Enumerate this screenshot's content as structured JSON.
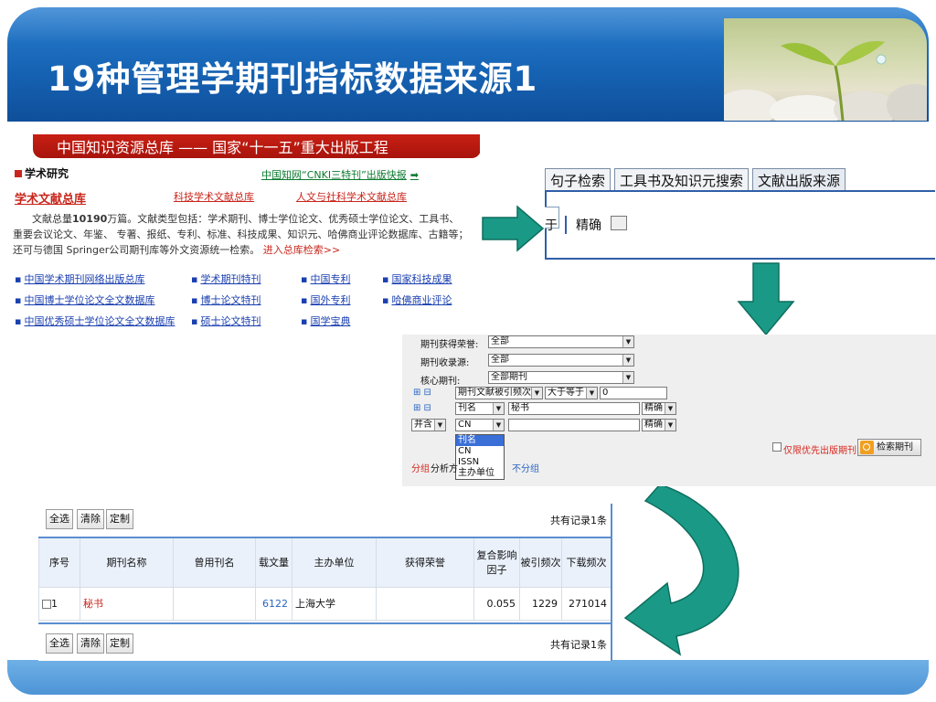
{
  "slide": {
    "title": "19种管理学期刊指标数据来源1"
  },
  "source_page": {
    "banner": "中国知识资源总库 —— 国家“十一五”重大出版工程",
    "section_heading": "学术研究",
    "news_link": "中国知网“CNKI三特刊”出版快报",
    "tabs": [
      "学术文献总库",
      "科技学术文献总库",
      "人文与社科学术文献总库"
    ],
    "desc_prefix": "文献总量",
    "desc_count": "10190",
    "desc_body": "万篇。文献类型包括：学术期刊、博士学位论文、优秀硕士学位论文、工具书、 重要会议论文、年鉴、 专著、报纸、专利、标准、科技成果、知识元、哈佛商业评论数据库、古籍等；还可与德国 Springer公司期刊库等外文资源统一检索。",
    "desc_enter": "进入总库检索>>",
    "links": [
      [
        "中国学术期刊网络出版总库",
        "学术期刊特刊",
        "中国专利",
        "国家科技成果"
      ],
      [
        "中国博士学位论文全文数据库",
        "博士论文特刊",
        "国外专利",
        "哈佛商业评论"
      ],
      [
        "中国优秀硕士学位论文全文数据库",
        "硕士论文特刊",
        "国学宝典"
      ]
    ]
  },
  "search_tabs": {
    "tabs": [
      "句子检索",
      "工具书及知识元搜索",
      "文献出版来源"
    ],
    "fragment_left": "于",
    "fragment_right": "精确"
  },
  "filter_form": {
    "rows": [
      {
        "label": "期刊获得荣誉:",
        "value": "全部"
      },
      {
        "label": "期刊收录源:",
        "value": "全部"
      },
      {
        "label": "核心期刊:",
        "value": "全部期刊"
      }
    ],
    "cite_row": {
      "pm": "⊞ ⊟",
      "field": "期刊文献被引频次",
      "op": "大于等于",
      "value": "0"
    },
    "name_row": {
      "pm": "⊞ ⊟",
      "field": "刊名",
      "value": "秘书",
      "match": "精确"
    },
    "cn_row": {
      "logic": "并含",
      "field": "CN",
      "value": "",
      "match": "精确"
    },
    "dropdown_options": [
      "刊名",
      "CN",
      "ISSN",
      "主办单位"
    ],
    "dropdown_selected": "刊名",
    "group_label_red": "分组",
    "group_label_black": "分析方",
    "no_group": "不分组",
    "priority_checkbox": "仅限优先出版期刊",
    "search_button": "检索期刊"
  },
  "results": {
    "toolbar": {
      "select_all": "全选",
      "clear": "清除",
      "custom": "定制"
    },
    "total": "共有记录1条",
    "columns": [
      "序号",
      "期刊名称",
      "曾用刊名",
      "载文量",
      "主办单位",
      "获得荣誉",
      "复合影响因子",
      "被引频次",
      "下载频次"
    ],
    "rows": [
      {
        "index": "1",
        "name": "秘书",
        "former": "",
        "articles": "6122",
        "publisher": "上海大学",
        "honors": "",
        "impact": "0.055",
        "cited": "1229",
        "downloads": "271014"
      }
    ]
  },
  "colors": {
    "header_blue": "#1663b4",
    "arrow_teal": "#1a9a86",
    "cnki_red": "#c8261c",
    "link_blue": "#1a3fb0"
  }
}
